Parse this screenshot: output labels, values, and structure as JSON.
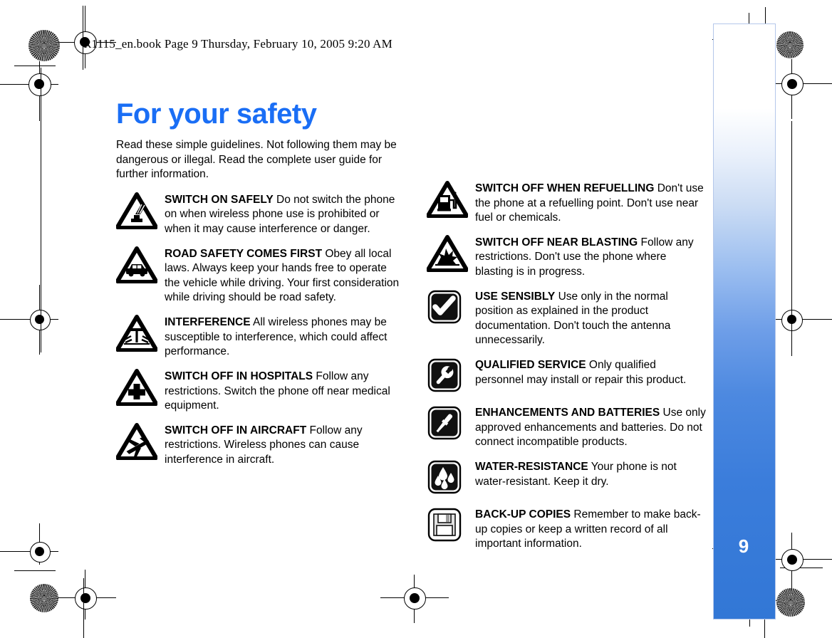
{
  "header": {
    "file_line": "R1115_en.book  Page 9  Thursday, February 10, 2005  9:20 AM"
  },
  "page": {
    "number": "9",
    "title": "For your safety",
    "accent_color": "#1a6ef5",
    "tab_gradient_bottom": "#3277d6"
  },
  "intro": "Read these simple guidelines. Not following them may be dangerous or illegal. Read the complete user guide for further information.",
  "left_column": [
    {
      "icon": "switch-on-safely-icon",
      "heading": "SWITCH ON SAFELY",
      "body": "Do not switch the phone on when wireless phone use is prohibited or when it may cause interference or danger."
    },
    {
      "icon": "car-icon",
      "heading": "ROAD SAFETY COMES FIRST",
      "body": "Obey all local laws. Always keep your hands free to operate the vehicle while driving. Your first consideration while driving should be road safety."
    },
    {
      "icon": "interference-antenna-icon",
      "heading": "INTERFERENCE",
      "body": "All wireless phones may be susceptible to interference, which could affect performance."
    },
    {
      "icon": "hospital-cross-icon",
      "heading": "SWITCH OFF IN HOSPITALS",
      "body": "Follow any restrictions. Switch the phone off near medical equipment."
    },
    {
      "icon": "aircraft-icon",
      "heading": "SWITCH OFF IN AIRCRAFT",
      "body": "Follow any restrictions. Wireless phones can cause interference in aircraft."
    }
  ],
  "right_column": [
    {
      "icon": "fuel-pump-icon",
      "heading": "SWITCH OFF WHEN REFUELLING",
      "body": "Don't use the phone at a refuelling point. Don't use near fuel or chemicals."
    },
    {
      "icon": "blasting-explosion-icon",
      "heading": "SWITCH OFF NEAR BLASTING",
      "body": "Follow any restrictions. Don't use the phone where blasting is in progress."
    },
    {
      "icon": "checkmark-icon",
      "heading": "USE SENSIBLY",
      "body": "Use only in the normal position as explained in the product documentation. Don't touch the antenna unnecessarily."
    },
    {
      "icon": "wrench-icon",
      "heading": "QUALIFIED SERVICE",
      "body": "Only qualified personnel may install or repair this product."
    },
    {
      "icon": "screwdriver-icon",
      "heading": "ENHANCEMENTS AND BATTERIES",
      "body": "Use only approved enhancements and batteries. Do not connect incompatible products."
    },
    {
      "icon": "water-drops-icon",
      "heading": "WATER-RESISTANCE",
      "body": "Your phone is not water-resistant. Keep it dry."
    },
    {
      "icon": "floppy-disk-icon",
      "heading": "BACK-UP COPIES",
      "body": "Remember to make back-up copies or keep a written record of all important information."
    }
  ]
}
